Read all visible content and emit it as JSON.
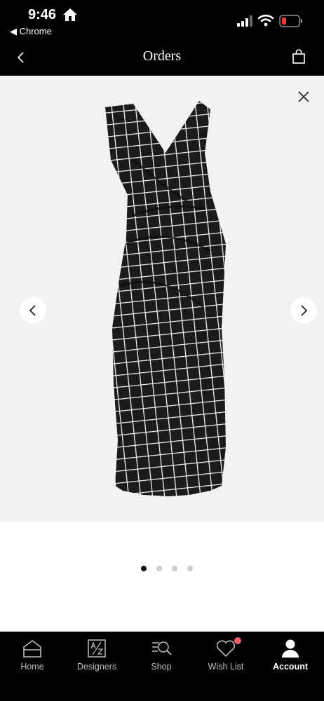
{
  "status_bar": {
    "time": "9:46",
    "back_app_label": "◀ Chrome"
  },
  "nav": {
    "title": "Orders"
  },
  "gallery": {
    "image_alt": "Black and white grid print sleeveless dress",
    "total_images": 4,
    "current_index": 1
  },
  "tabs": [
    {
      "label": "Home",
      "icon": "home-icon"
    },
    {
      "label": "Designers",
      "icon": "designers-az-icon"
    },
    {
      "label": "Shop",
      "icon": "shop-search-icon"
    },
    {
      "label": "Wish List",
      "icon": "heart-icon"
    },
    {
      "label": "Account",
      "icon": "account-icon"
    }
  ],
  "colors": {
    "background": "#000000",
    "image_backdrop": "#f2f2f1",
    "dress": "#1b1b1b",
    "badge": "#f0606a",
    "battery_low": "#ff3b30"
  }
}
